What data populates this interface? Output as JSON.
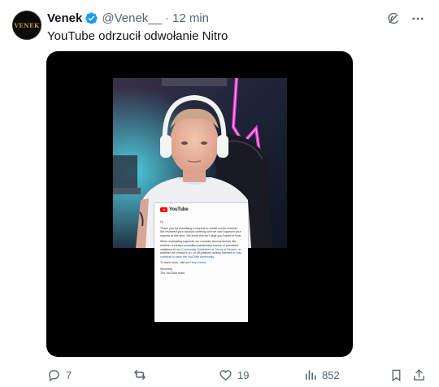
{
  "author": {
    "name": "Venek",
    "handle": "@Venek__",
    "separator": "·",
    "time": "12 min",
    "avatar_text": "VENEK",
    "verified": true
  },
  "tweet": {
    "text": "YouTube odrzucił odwołanie Nitro"
  },
  "media": {
    "letter": {
      "logo": "YouTube",
      "greeting": "Hi,",
      "p1": "Thank you for submitting a request to create a new channel. We reviewed your account carefully and we can't approve your request at this time. We know this isn't what you hoped to hear.",
      "p2_a": "When evaluating requests, we consider several factors like whether a creator committed particularly severe or persistent violations of our",
      "p2_link1": "Community Guidelines",
      "p2_b": "or",
      "p2_link2": "Terms of Service,",
      "p2_c": "or whether the creator's on- or off-platform activity harmed or",
      "p2_link3": "may continue to harm the YouTube community.",
      "p3_a": "To learn more, visit our",
      "p3_link": "Help Center.",
      "signoff": "Sincerely,",
      "team": "The YouTube team"
    }
  },
  "actions": {
    "replies": "7",
    "reposts": "",
    "likes": "19",
    "views": "852"
  },
  "icons": {
    "top": [
      "grok-icon",
      "more-icon"
    ],
    "actions": [
      "reply-icon",
      "repost-icon",
      "like-icon",
      "views-icon",
      "bookmark-icon",
      "share-icon"
    ]
  },
  "colors": {
    "text": "#0f1419",
    "secondary": "#536471",
    "verified": "#1d9bf0",
    "media_bg": "#000000"
  }
}
